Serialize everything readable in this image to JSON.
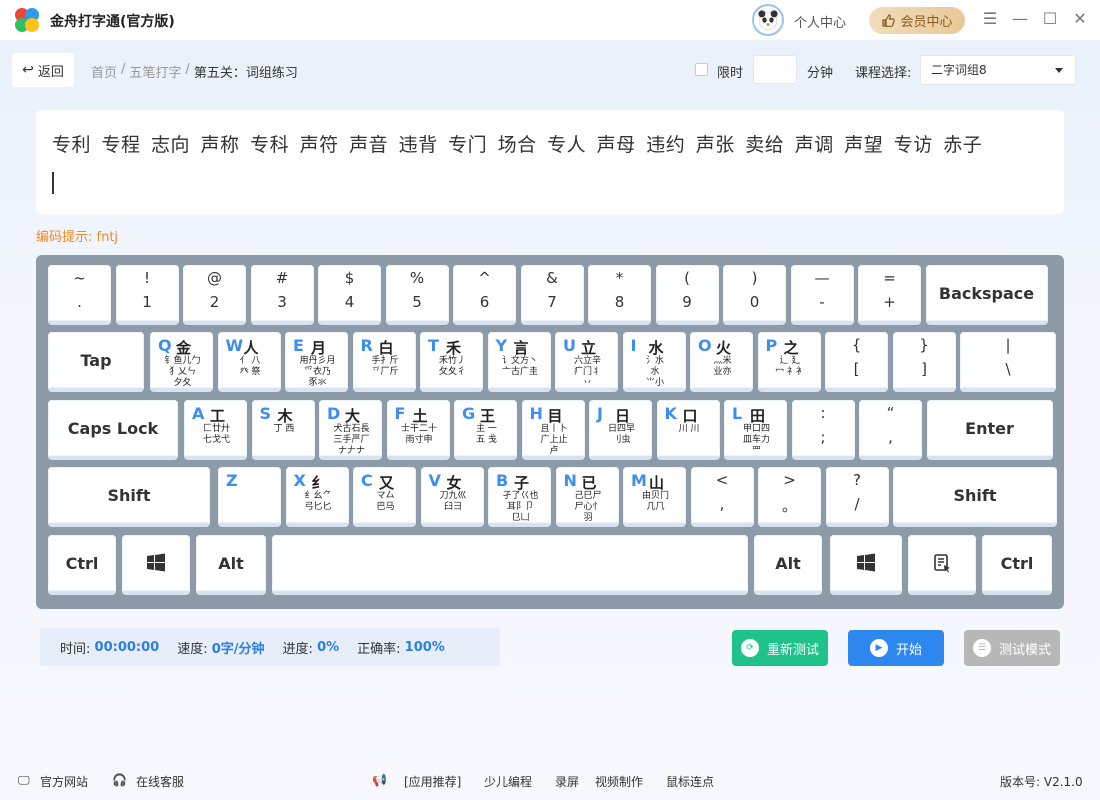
{
  "app": {
    "title": "金舟打字通(官方版)"
  },
  "header": {
    "user_center": "个人中心",
    "vip_center": "会员中心"
  },
  "nav": {
    "back": "返回",
    "breadcrumb": [
      "首页",
      "五笔打字",
      "第五关：词组练习"
    ],
    "limit_label": "限时",
    "minute_value": "",
    "minute_label": "分钟",
    "course_label": "课程选择:",
    "course_value": "二字词组8"
  },
  "practice": {
    "words": [
      "专利",
      "专程",
      "志向",
      "声称",
      "专科",
      "声符",
      "声音",
      "违背",
      "专门",
      "场合",
      "专人",
      "声母",
      "违约",
      "声张",
      "卖给",
      "声调",
      "声望",
      "专访",
      "赤子"
    ],
    "hint": "编码提示: fntj"
  },
  "keyboard": {
    "row1": [
      {
        "top": "~",
        "bottom": "."
      },
      {
        "top": "!",
        "bottom": "1"
      },
      {
        "top": "@",
        "bottom": "2"
      },
      {
        "top": "#",
        "bottom": "3"
      },
      {
        "top": "$",
        "bottom": "4"
      },
      {
        "top": "%",
        "bottom": "5"
      },
      {
        "top": "^",
        "bottom": "6"
      },
      {
        "top": "&",
        "bottom": "7"
      },
      {
        "top": "*",
        "bottom": "8"
      },
      {
        "top": "(",
        "bottom": "9"
      },
      {
        "top": ")",
        "bottom": "0"
      },
      {
        "top": "—",
        "bottom": "-"
      },
      {
        "top": "=",
        "bottom": "+"
      }
    ],
    "backspace": "Backspace",
    "tab": "Tap",
    "row2": [
      {
        "letter": "Q",
        "root": "金",
        "rad": "钅鱼儿勹\n犭乂ㄣ\n夕夂"
      },
      {
        "letter": "W",
        "root": "人",
        "rad": "亻 八\n癶 祭"
      },
      {
        "letter": "E",
        "root": "月",
        "rad": "用丹彡月\n爫衣乃\n豕氺"
      },
      {
        "letter": "R",
        "root": "白",
        "rad": "手扌斤\n乊厂斤"
      },
      {
        "letter": "T",
        "root": "禾",
        "rad": "禾竹丿\n攵夂彳"
      },
      {
        "letter": "Y",
        "root": "言",
        "rad": "讠文方丶\n亠古广圭"
      },
      {
        "letter": "U",
        "root": "立",
        "rad": "六立辛\n疒门丬\n丷"
      },
      {
        "letter": "I",
        "root": "水",
        "rad": "氵水\n水\n⺌小"
      },
      {
        "letter": "O",
        "root": "火",
        "rad": "灬米\n业亦"
      },
      {
        "letter": "P",
        "root": "之",
        "rad": "辶 廴\n冖 礻衤"
      }
    ],
    "row2_sym": [
      {
        "top": "{",
        "bottom": "["
      },
      {
        "top": "}",
        "bottom": "]"
      },
      {
        "top": "|",
        "bottom": "\\"
      }
    ],
    "caps": "Caps Lock",
    "row3": [
      {
        "letter": "A",
        "root": "工",
        "rad": "匚廿廾\n七戈弋"
      },
      {
        "letter": "S",
        "root": "木",
        "rad": "丁 西"
      },
      {
        "letter": "D",
        "root": "大",
        "rad": "犬古石長\n三手严厂\nナ𠂇ナ"
      },
      {
        "letter": "F",
        "root": "土",
        "rad": "士干二十\n雨寸申"
      },
      {
        "letter": "G",
        "root": "王",
        "rad": "主 一\n五 戋"
      },
      {
        "letter": "H",
        "root": "目",
        "rad": "且丨卜\n广上止\n卢"
      },
      {
        "letter": "J",
        "root": "日",
        "rad": "日四早\n刂虫"
      },
      {
        "letter": "K",
        "root": "口",
        "rad": "川 川"
      },
      {
        "letter": "L",
        "root": "田",
        "rad": "甲口四\n皿车力\n罒"
      }
    ],
    "row3_sym": [
      {
        "top": ":",
        "bottom": ";"
      },
      {
        "top": "“",
        "bottom": ","
      }
    ],
    "enter": "Enter",
    "shift": "Shift",
    "row4": [
      {
        "letter": "Z",
        "root": "",
        "rad": ""
      },
      {
        "letter": "X",
        "root": "纟",
        "rad": "纟幺⺈\n弓匕匕"
      },
      {
        "letter": "C",
        "root": "又",
        "rad": "マ厶\n巴马"
      },
      {
        "letter": "V",
        "root": "女",
        "rad": "刀九巛\n臼彐"
      },
      {
        "letter": "B",
        "root": "子",
        "rad": "孑了巜也\n耳阝卩\n㔾凵"
      },
      {
        "letter": "N",
        "root": "已",
        "rad": "己巳尸\n尸心忄\n羽"
      },
      {
        "letter": "M",
        "root": "山",
        "rad": "由贝冂\n几𠘨"
      }
    ],
    "row4_sym": [
      {
        "top": "<",
        "bottom": ","
      },
      {
        "top": ">",
        "bottom": "。"
      },
      {
        "top": "?",
        "bottom": "/"
      }
    ],
    "ctrl": "Ctrl",
    "alt": "Alt"
  },
  "stats": {
    "time_label": "时间:",
    "time": "00:00:00",
    "speed_label": "速度:",
    "speed": "0字/分钟",
    "progress_label": "进度:",
    "progress": "0%",
    "accuracy_label": "正确率:",
    "accuracy": "100%"
  },
  "actions": {
    "retest": "重新测试",
    "start": "开始",
    "test_mode": "测试模式"
  },
  "footer": {
    "official_site": "官方网站",
    "online_service": "在线客服",
    "promo_label": "[应用推荐]",
    "promo": [
      "少儿编程",
      "录屏",
      "视频制作",
      "鼠标连点"
    ],
    "version": "版本号:  V2.1.0"
  },
  "colors": {
    "accent": "#2a7ee8",
    "green": "#1fc28a",
    "blue": "#2e86ef",
    "gray": "#b7b7b7",
    "hint": "#f08a2a"
  }
}
